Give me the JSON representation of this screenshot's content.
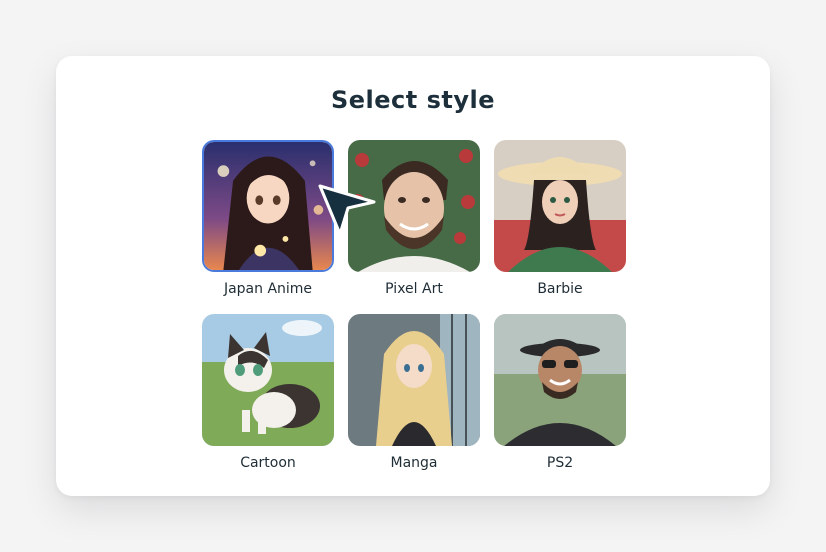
{
  "dialog": {
    "title": "Select style"
  },
  "styles": [
    {
      "label": "Japan Anime",
      "selected": true
    },
    {
      "label": "Pixel Art",
      "selected": false
    },
    {
      "label": "Barbie",
      "selected": false
    },
    {
      "label": "Cartoon",
      "selected": false
    },
    {
      "label": "Manga",
      "selected": false
    },
    {
      "label": "PS2",
      "selected": false
    }
  ],
  "colors": {
    "title": "#1c2f3b",
    "selection_border": "#4a7bdc",
    "cursor": "#17303f"
  },
  "icons": {
    "cursor": "pointer-cursor-icon"
  }
}
